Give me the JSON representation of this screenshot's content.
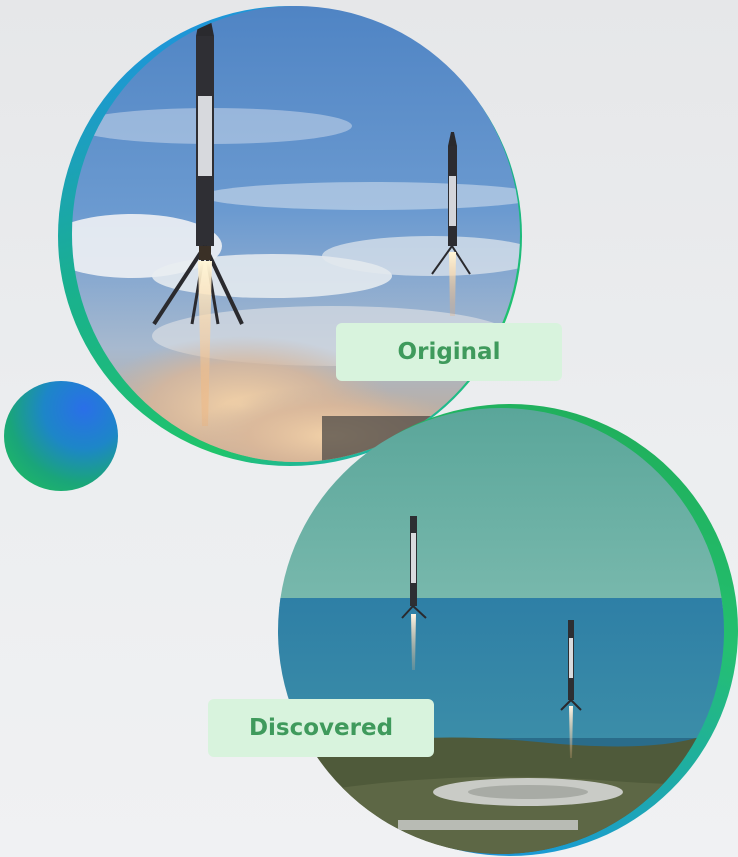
{
  "labels": {
    "original": "Original",
    "discovered": "Discovered"
  },
  "images": {
    "original": "rocket-boosters-landing-photo",
    "discovered": "rocket-boosters-landing-over-sea-photo"
  },
  "colors": {
    "label_background": "#d8f3dd",
    "label_text": "#3f9a5c",
    "accent_green": "#20c46a",
    "accent_blue": "#2c72e8"
  }
}
